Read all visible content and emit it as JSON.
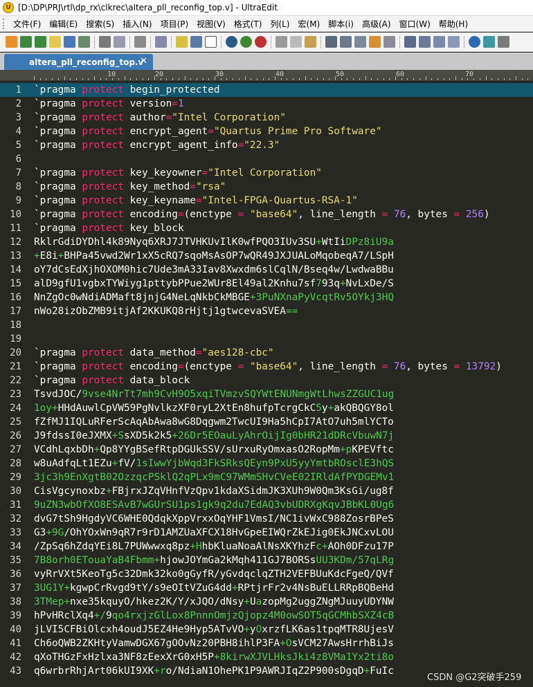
{
  "window": {
    "title": "[D:\\DP\\PRJ\\rtl\\dp_rx\\clkrec\\altera_pll_reconfig_top.v] - UltraEdit",
    "app_icon_letter": "U"
  },
  "menu": [
    "文件(F)",
    "编辑(E)",
    "搜索(S)",
    "插入(N)",
    "项目(P)",
    "视图(V)",
    "格式(T)",
    "列(L)",
    "宏(M)",
    "脚本(i)",
    "高级(A)",
    "窗口(W)",
    "帮助(H)"
  ],
  "tab": {
    "label": "altera_pll_reconfig_top.v",
    "close": "✕"
  },
  "ruler": [
    "10",
    "20",
    "30",
    "40",
    "50",
    "60",
    "70"
  ],
  "colors": {
    "editor_bg": "#272822",
    "current_line": "#11586e",
    "keyword": "#f92672",
    "string": "#e6db74",
    "number": "#ae81ff",
    "base64_green": "#4ec94e"
  },
  "lines": [
    {
      "n": "1",
      "t": "`pragma protect begin_protected"
    },
    {
      "n": "2",
      "t": "`pragma protect version=1"
    },
    {
      "n": "3",
      "t": "`pragma protect author=\"Intel Corporation\""
    },
    {
      "n": "4",
      "t": "`pragma protect encrypt_agent=\"Quartus Prime Pro Software\""
    },
    {
      "n": "5",
      "t": "`pragma protect encrypt_agent_info=\"22.3\""
    },
    {
      "n": "6",
      "t": ""
    },
    {
      "n": "7",
      "t": "`pragma protect key_keyowner=\"Intel Corporation\""
    },
    {
      "n": "8",
      "t": "`pragma protect key_method=\"rsa\""
    },
    {
      "n": "9",
      "t": "`pragma protect key_keyname=\"Intel-FPGA-Quartus-RSA-1\""
    },
    {
      "n": "10",
      "t": "`pragma protect encoding=(enctype = \"base64\", line_length = 76, bytes = 256)"
    },
    {
      "n": "11",
      "t": "`pragma protect key_block"
    },
    {
      "n": "12",
      "t": "RklrGdiDYDhl4k89Nyq6XRJ7JTVHKUvIlK0wfPQO3IUv3SU+WtIiDPz8iU9a"
    },
    {
      "n": "13",
      "t": "+E8i+BHPa45vwd2Wr1xX5cRQ7sqoMsAsOP7wQR49JXJUALoMqobeqA7/LSpH"
    },
    {
      "n": "14",
      "t": "oY7dCsEdXjhOXOM0hic7Ude3mA33Iav8Xwxdm6slCqlN/Bseq4w/LwdwaBBu"
    },
    {
      "n": "15",
      "t": "alD9gfU1vgbxTYWiyg1pttybPPue2WUr8El49al2Knhu7sf793q+NvLxDe/S"
    },
    {
      "n": "16",
      "t": "NnZgOc0wNdiADMaft8jnjG4NeLqNkbCkMBGE+3PuNXnaPyVcqtRv5OYkj3HQ"
    },
    {
      "n": "17",
      "t": "nWo28izObZMB9itjAf2KKUKQ8rHjtj1gtwcevaSVEA=="
    },
    {
      "n": "18",
      "t": ""
    },
    {
      "n": "19",
      "t": ""
    },
    {
      "n": "20",
      "t": "`pragma protect data_method=\"aes128-cbc\""
    },
    {
      "n": "21",
      "t": "`pragma protect encoding=(enctype = \"base64\", line_length = 76, bytes = 13792)"
    },
    {
      "n": "22",
      "t": "`pragma protect data_block"
    },
    {
      "n": "23",
      "t": "TsvdJOC/9vse4NrTt7mh9CvH9O5xqiTVmzvSQYWtENUNmgWtLhwsZZGUC1ug"
    },
    {
      "n": "24",
      "t": "1oy+HHdAuwlCpVW59PgNvlkzXF0ryL2XtEn8hufpTcrgCkC5y+akQBQGY8ol"
    },
    {
      "n": "25",
      "t": "fZfMJ1IQLuRFerScAqAbAwa8wG8Dqgwm2TwcUI9Ha5hCpI7AtO7uh5mlYCTo"
    },
    {
      "n": "26",
      "t": "J9fdssI0eJXMX+SsXD5k2k5+26Dr5EOauLyAhrOijIg0bHR21dDRcVbuwN7j"
    },
    {
      "n": "27",
      "t": "VCdhLqxbDh+Qp8YYgBSefRtpDGUkSSV/sUrxuRyOmxasO2RopMm+pKPEVftc"
    },
    {
      "n": "28",
      "t": "w8uAdfqLt1EZu+fV/1sIwwYjbWqd3FkSRksQEyn9PxU5yyYmtbROsclE3hQS"
    },
    {
      "n": "29",
      "t": "3jc3h9EnXgtB02OzzqcPSklQ2qPLx9mC97WMmSHvCVeE02IRldAfPYDGEMv1"
    },
    {
      "n": "30",
      "t": "CisVgcynoxbz+FBjrxJZqVHnfVzQpv1kdaXSidmJK3XUh9W0Qm3KsGi/ug8f"
    },
    {
      "n": "31",
      "t": "9uZN3wbOfXO8ESAvB7wGUrSU1ps1gk9q2du7EdAQ3vbUDRXgKqvJBbKL0Ug6"
    },
    {
      "n": "32",
      "t": "dvG7tSh9HgdyVC6WHE0QdqkXppVrxxOqYHF1VmsI/NC1ivWxC988ZosrBPeS"
    },
    {
      "n": "33",
      "t": "G3+9G/OhYOxWn9qR7r9rD1AMZUaXFCX18HvGpeEIWQrZkEJig0EkJNCxvLOU"
    },
    {
      "n": "34",
      "t": "/ZpSq6hZdqYEi8L7PUWwwxq8pz+HhbKluaNoaAlNsXKYhzFc+AOh0DFzu17P"
    },
    {
      "n": "35",
      "t": "7B8orh0ETouaYaB4Fbmm+hjowJOYmGa2kMqh411GJ7BORSsUU3KDm/57qLRg"
    },
    {
      "n": "36",
      "t": "vyRrVXt5KeoTg5c32Dmk32ko0gGyfR/yGvdqclqZTH2VEFBUuKdcFgeQ/QVf"
    },
    {
      "n": "37",
      "t": "3UG1Y+kgwpCrRvgd9tY/s9eOItVZuG4dd+RPtjrFr2v4NsBuELLRRpBQBeHd"
    },
    {
      "n": "38",
      "t": "3TMep+nxe35kquyO/hkez2K/Y/xJQO/dNsy+UazopMg2uggZNgMJuuyUDYNW"
    },
    {
      "n": "39",
      "t": "hPvHRclXq4+/9qo4rxjzGlLox8PnnnOmjzQjopz4M0owSOT5qGCMhbSXZ4cB"
    },
    {
      "n": "40",
      "t": "jLVI5CFBiOlcxh4oudJ5EZ4He9Hyp5ATvVO+yOxrzfLK6as1tpqMTR8UjesV"
    },
    {
      "n": "41",
      "t": "Ch6oQWB2ZKHtyVamwDGX67gOOvNz20PBH8ihlP3FA+OsVCM27AwsHrrhBiJs"
    },
    {
      "n": "42",
      "t": "qXoTHGzFxHzlxa3NF8zEexXrG0xH5P+8kirwXJVLHksJki4z8VMa1Yx2ti8o"
    },
    {
      "n": "43",
      "t": "q6wrbrRhjArt06kUI9XK+ro/NdiaN1OhePK1P9AWRJIqZ2P900sDgqD+FuIc"
    }
  ],
  "watermark": "CSDN @G2突破手259"
}
